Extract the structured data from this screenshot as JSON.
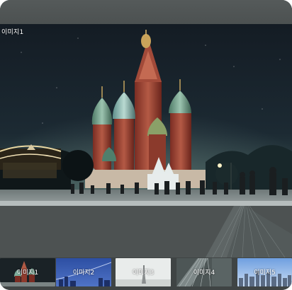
{
  "gallery": {
    "current_caption": "이미지1",
    "thumbnails": [
      {
        "label": "이미지1",
        "scene": "cathedral"
      },
      {
        "label": "이미지2",
        "scene": "blue-skyline"
      },
      {
        "label": "이미지3",
        "scene": "foggy-tower"
      },
      {
        "label": "이미지4",
        "scene": "bridge-cables"
      },
      {
        "label": "이미지5",
        "scene": "city-skyline"
      }
    ]
  }
}
